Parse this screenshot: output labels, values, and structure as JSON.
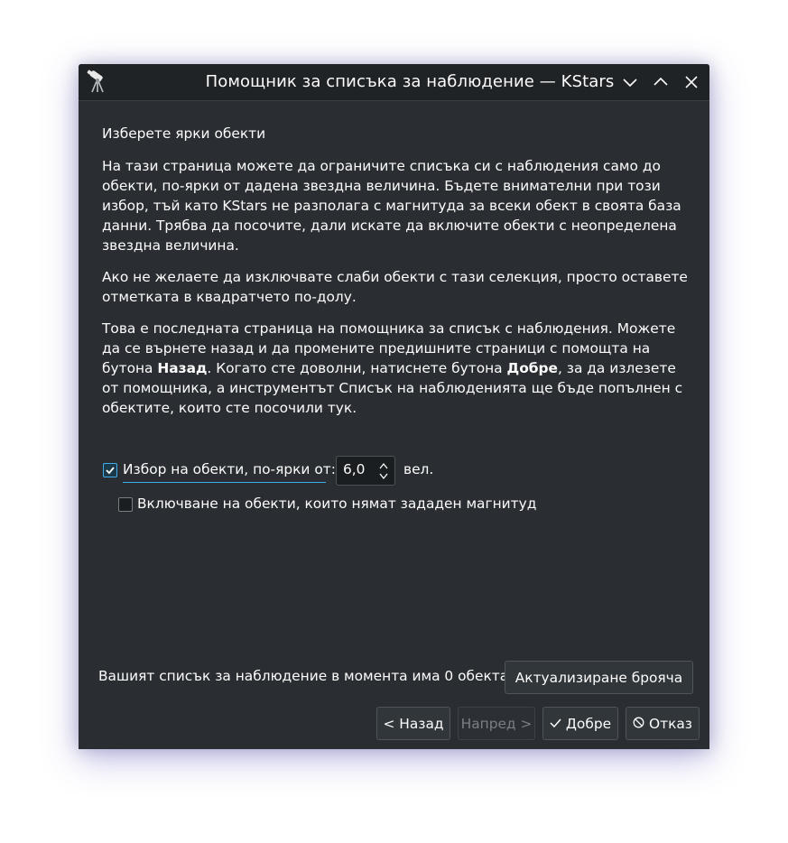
{
  "window": {
    "title": "Помощник за списъка за наблюдение — KStars",
    "icons": {
      "app": "telescope-icon",
      "minimize": "chevron-down-icon",
      "maximize": "chevron-up-icon",
      "close": "close-icon"
    }
  },
  "page": {
    "heading": "Изберете ярки обекти",
    "paragraph1": "На тази страница можете да ограничите списъка си с наблюдения само до обекти, по-ярки от дадена звездна величина. Бъдете внимателни при този избор, тъй като KStars не разполага с магнитуда за всеки обект в своята база данни. Трябва да посочите, дали искате да включите обекти с неопределена звездна величина.",
    "paragraph2": "Ако не желаете да изключвате слаби обекти с тази селекция, просто оставете отметката в квадратчето по-долу.",
    "paragraph3": {
      "part1": "Това е последната страница на помощника за списък с наблюдения. Можете да се върнете назад и да промените предишните страници с помощта на бутона ",
      "bold1": "Назад",
      "part2": ". Когато сте доволни, натиснете бутона ",
      "bold2": "Добре",
      "part3": ", за да излезете от помощника, а инструментът Списък на наблюденията ще бъде попълнен с обектите, които сте посочили тук."
    }
  },
  "options": {
    "brighter_checkbox": {
      "label": "Избор на обекти, по-ярки от:",
      "checked": true
    },
    "magnitude": {
      "value": "6,0",
      "unit": "вел."
    },
    "include_unknown_checkbox": {
      "label": "Включване на обекти, които нямат зададен магнитуд",
      "checked": false
    }
  },
  "footer": {
    "status": "Вашият списък за наблюдение в момента има 0 обекта.",
    "update_button": "Актуализиране брояча",
    "back_button": "< Назад",
    "next_button": "Напред >",
    "ok_button": "Добре",
    "cancel_button": "Отказ"
  },
  "colors": {
    "accent": "#3daee9",
    "window_bg": "#2a2e32",
    "titlebar_bg": "#202326"
  }
}
